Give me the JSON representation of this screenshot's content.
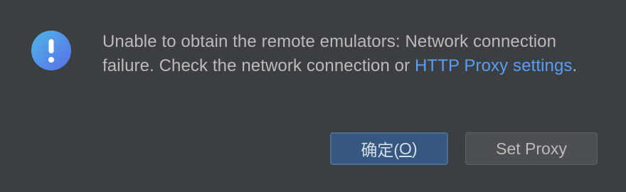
{
  "dialog": {
    "icon": "exclamation-icon",
    "message_prefix": "Unable to obtain the remote emulators: Network connection failure. Check the network connection or ",
    "link_text": "HTTP Proxy settings",
    "message_suffix": ".",
    "colors": {
      "background": "#3c3f41",
      "text": "#bbbbbb",
      "link": "#589df6",
      "primary_button": "#365880",
      "icon_gradient_start": "#4fb5e8",
      "icon_gradient_end": "#5a6ee8"
    }
  },
  "buttons": {
    "ok_label_main": "确定(",
    "ok_label_mnemonic": "O",
    "ok_label_close": ")",
    "set_proxy_label": "Set Proxy"
  }
}
